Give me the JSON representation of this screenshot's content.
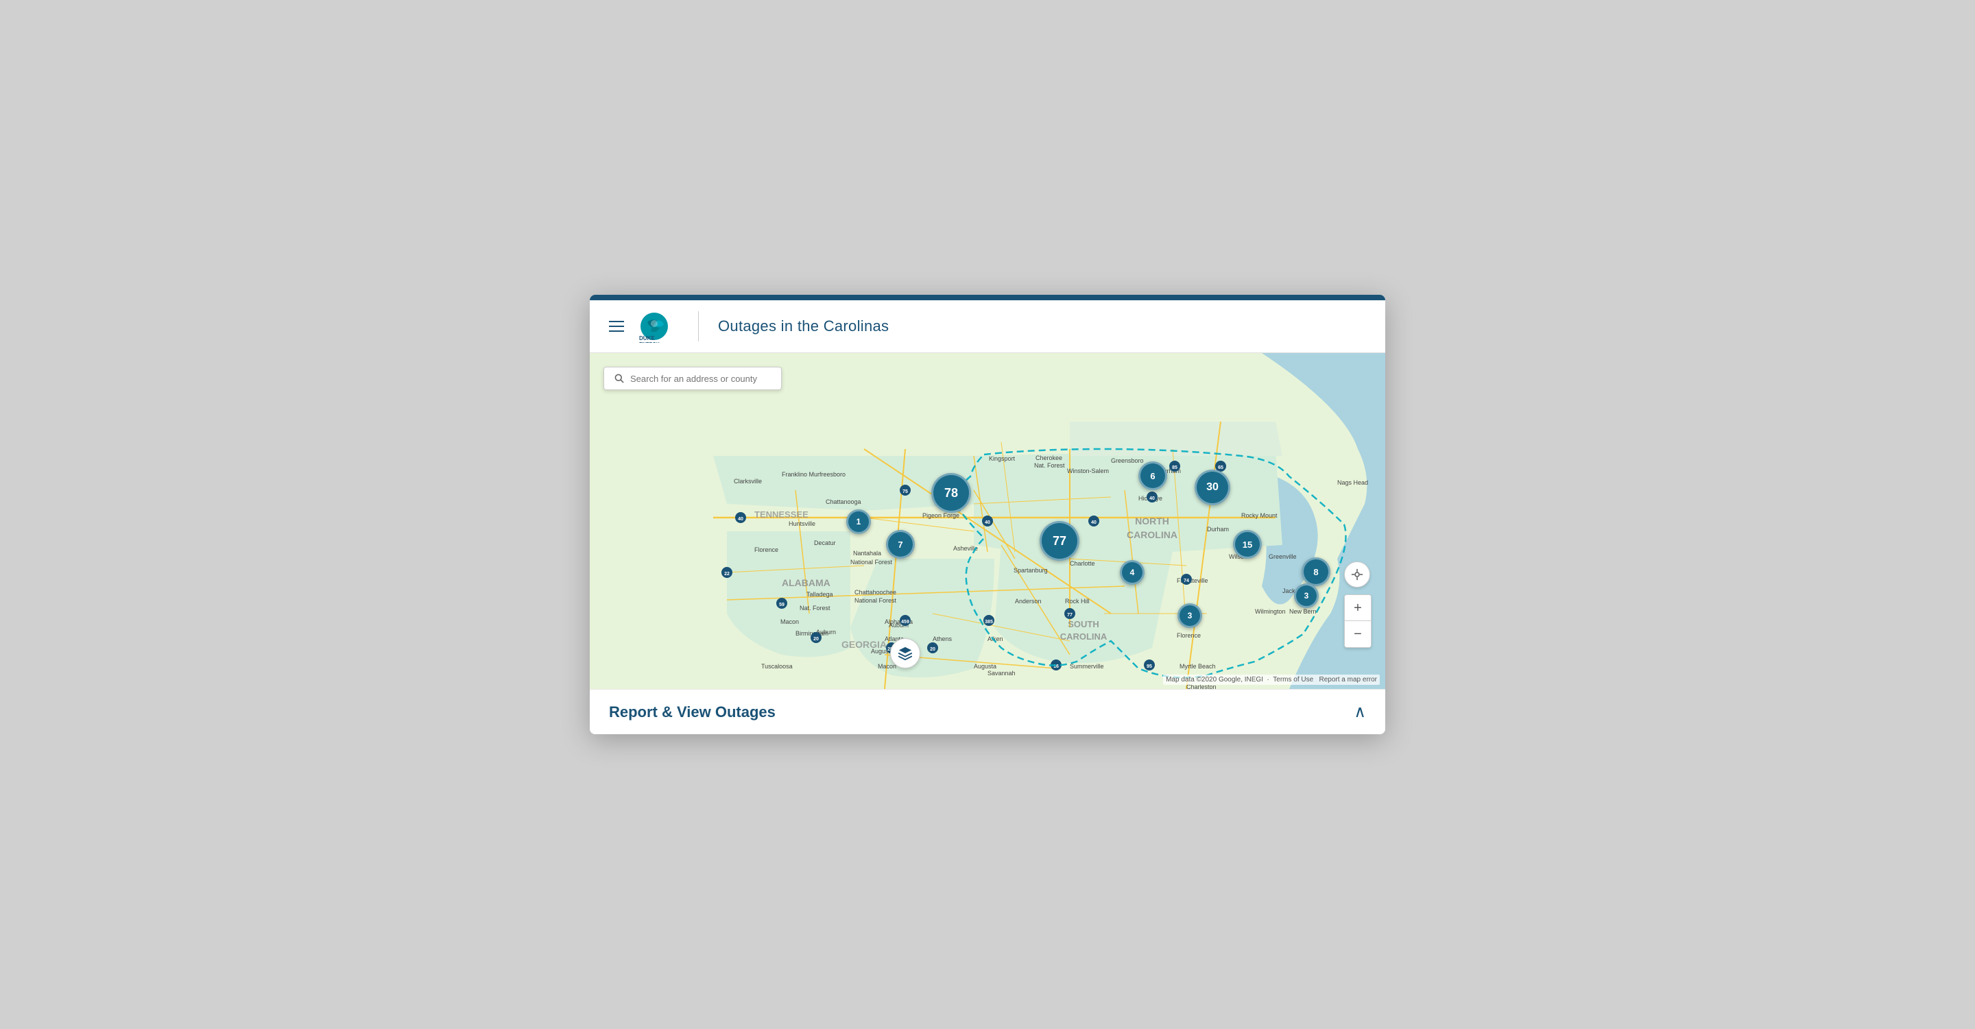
{
  "header": {
    "title": "Outages in the Carolinas",
    "logo_alt": "Duke Energy"
  },
  "search": {
    "placeholder": "Search for an address or county"
  },
  "clusters": [
    {
      "id": "c1",
      "label": "78",
      "size": "xl",
      "top": "195",
      "left": "505"
    },
    {
      "id": "c2",
      "label": "6",
      "size": "md",
      "top": "175",
      "left": "805"
    },
    {
      "id": "c3",
      "label": "30",
      "size": "lg",
      "top": "200",
      "left": "887"
    },
    {
      "id": "c4",
      "label": "1",
      "size": "sm",
      "top": "240",
      "left": "378"
    },
    {
      "id": "c5",
      "label": "7",
      "size": "md",
      "top": "270",
      "left": "440"
    },
    {
      "id": "c6",
      "label": "77",
      "size": "xl",
      "top": "258",
      "left": "660"
    },
    {
      "id": "c7",
      "label": "15",
      "size": "md",
      "top": "270",
      "left": "940"
    },
    {
      "id": "c8",
      "label": "4",
      "size": "sm",
      "top": "310",
      "left": "778"
    },
    {
      "id": "c9",
      "label": "8",
      "size": "md",
      "top": "305",
      "left": "1040"
    },
    {
      "id": "c10",
      "label": "3",
      "size": "sm",
      "top": "370",
      "left": "860"
    },
    {
      "id": "c11",
      "label": "3",
      "size": "sm",
      "top": "340",
      "left": "1030"
    }
  ],
  "zoom": {
    "plus_label": "+",
    "minus_label": "−"
  },
  "map_attribution": {
    "text": "Map data ©2020 Google, INEGI",
    "terms": "Terms of Use",
    "error": "Report a map error"
  },
  "footer": {
    "title": "Report & View Outages",
    "chevron": "^"
  }
}
